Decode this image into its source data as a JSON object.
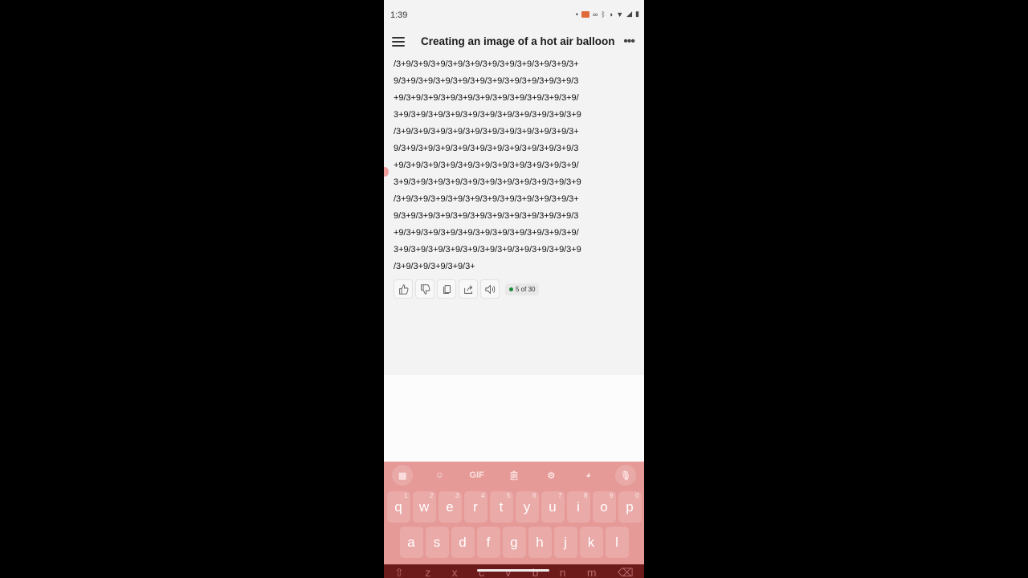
{
  "status_bar": {
    "time": "1:39",
    "icons": [
      "notification-dot",
      "cast-icon",
      "voicemail-icon",
      "bluetooth-icon",
      "vibrate-icon",
      "wifi-icon",
      "signal-icon",
      "battery-icon"
    ]
  },
  "app_bar": {
    "title": "Creating an image of a hot air balloon",
    "menu_icon": "hamburger-menu-icon",
    "more_icon": "more-options-icon",
    "more_label": "•••"
  },
  "message": {
    "lines": [
      "/3+9/3+9/3+9/3+9/3+9/3+9/3+9/3+9/3+9/3+9/3+",
      "9/3+9/3+9/3+9/3+9/3+9/3+9/3+9/3+9/3+9/3+9/3",
      "+9/3+9/3+9/3+9/3+9/3+9/3+9/3+9/3+9/3+9/3+9/",
      "3+9/3+9/3+9/3+9/3+9/3+9/3+9/3+9/3+9/3+9/3+9",
      "/3+9/3+9/3+9/3+9/3+9/3+9/3+9/3+9/3+9/3+9/3+",
      "9/3+9/3+9/3+9/3+9/3+9/3+9/3+9/3+9/3+9/3+9/3",
      "+9/3+9/3+9/3+9/3+9/3+9/3+9/3+9/3+9/3+9/3+9/",
      "3+9/3+9/3+9/3+9/3+9/3+9/3+9/3+9/3+9/3+9/3+9",
      "/3+9/3+9/3+9/3+9/3+9/3+9/3+9/3+9/3+9/3+9/3+",
      "9/3+9/3+9/3+9/3+9/3+9/3+9/3+9/3+9/3+9/3+9/3",
      "+9/3+9/3+9/3+9/3+9/3+9/3+9/3+9/3+9/3+9/3+9/",
      "3+9/3+9/3+9/3+9/3+9/3+9/3+9/3+9/3+9/3+9/3+9",
      "/3+9/3+9/3+9/3+9/3+"
    ]
  },
  "actions": {
    "buttons": [
      "thumbs-up",
      "thumbs-down",
      "copy",
      "share",
      "read-aloud"
    ],
    "counter": "5 of 30",
    "counter_dot_color": "#1b8a3a"
  },
  "keyboard": {
    "toolbar": [
      "apps",
      "sticker",
      "GIF",
      "clipboard",
      "settings",
      "theme",
      "microphone"
    ],
    "gif_label": "GIF",
    "row1": [
      {
        "k": "q",
        "n": "1"
      },
      {
        "k": "w",
        "n": "2"
      },
      {
        "k": "e",
        "n": "3"
      },
      {
        "k": "r",
        "n": "4"
      },
      {
        "k": "t",
        "n": "5"
      },
      {
        "k": "y",
        "n": "6"
      },
      {
        "k": "u",
        "n": "7"
      },
      {
        "k": "i",
        "n": "8"
      },
      {
        "k": "o",
        "n": "9"
      },
      {
        "k": "p",
        "n": "0"
      }
    ],
    "row2": [
      "a",
      "s",
      "d",
      "f",
      "g",
      "h",
      "j",
      "k",
      "l"
    ],
    "row3": [
      "⇧",
      "z",
      "x",
      "c",
      "v",
      "b",
      "n",
      "m",
      "⌫"
    ],
    "accent_color": "#e59a98"
  }
}
